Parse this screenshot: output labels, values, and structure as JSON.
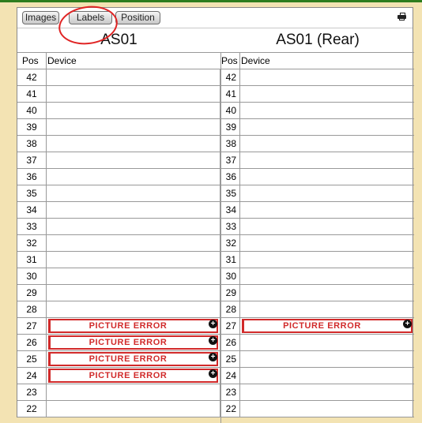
{
  "toolbar": {
    "images_label": "Images",
    "labels_label": "Labels",
    "position_label": "Position"
  },
  "icons": {
    "print": "printer-icon",
    "add": "plus-circle-icon"
  },
  "colors": {
    "device_border": "#d12a2a",
    "annotation": "#e02424"
  },
  "racks": [
    {
      "title": "AS01",
      "pos_header": "Pos",
      "device_header": "Device",
      "rows": [
        {
          "pos": "42",
          "device": ""
        },
        {
          "pos": "41",
          "device": ""
        },
        {
          "pos": "40",
          "device": ""
        },
        {
          "pos": "39",
          "device": ""
        },
        {
          "pos": "38",
          "device": ""
        },
        {
          "pos": "37",
          "device": ""
        },
        {
          "pos": "36",
          "device": ""
        },
        {
          "pos": "35",
          "device": ""
        },
        {
          "pos": "34",
          "device": ""
        },
        {
          "pos": "33",
          "device": ""
        },
        {
          "pos": "32",
          "device": ""
        },
        {
          "pos": "31",
          "device": ""
        },
        {
          "pos": "30",
          "device": ""
        },
        {
          "pos": "29",
          "device": ""
        },
        {
          "pos": "28",
          "device": ""
        },
        {
          "pos": "27",
          "device": "PICTURE ERROR"
        },
        {
          "pos": "26",
          "device": "PICTURE ERROR"
        },
        {
          "pos": "25",
          "device": "PICTURE ERROR"
        },
        {
          "pos": "24",
          "device": "PICTURE ERROR"
        },
        {
          "pos": "23",
          "device": ""
        },
        {
          "pos": "22",
          "device": ""
        }
      ]
    },
    {
      "title": "AS01 (Rear)",
      "pos_header": "Pos",
      "device_header": "Device",
      "rows": [
        {
          "pos": "42",
          "device": ""
        },
        {
          "pos": "41",
          "device": ""
        },
        {
          "pos": "40",
          "device": ""
        },
        {
          "pos": "39",
          "device": ""
        },
        {
          "pos": "38",
          "device": ""
        },
        {
          "pos": "37",
          "device": ""
        },
        {
          "pos": "36",
          "device": ""
        },
        {
          "pos": "35",
          "device": ""
        },
        {
          "pos": "34",
          "device": ""
        },
        {
          "pos": "33",
          "device": ""
        },
        {
          "pos": "32",
          "device": ""
        },
        {
          "pos": "31",
          "device": ""
        },
        {
          "pos": "30",
          "device": ""
        },
        {
          "pos": "29",
          "device": ""
        },
        {
          "pos": "28",
          "device": ""
        },
        {
          "pos": "27",
          "device": "PICTURE ERROR"
        },
        {
          "pos": "26",
          "device": ""
        },
        {
          "pos": "25",
          "device": ""
        },
        {
          "pos": "24",
          "device": ""
        },
        {
          "pos": "23",
          "device": ""
        },
        {
          "pos": "22",
          "device": ""
        }
      ]
    }
  ]
}
